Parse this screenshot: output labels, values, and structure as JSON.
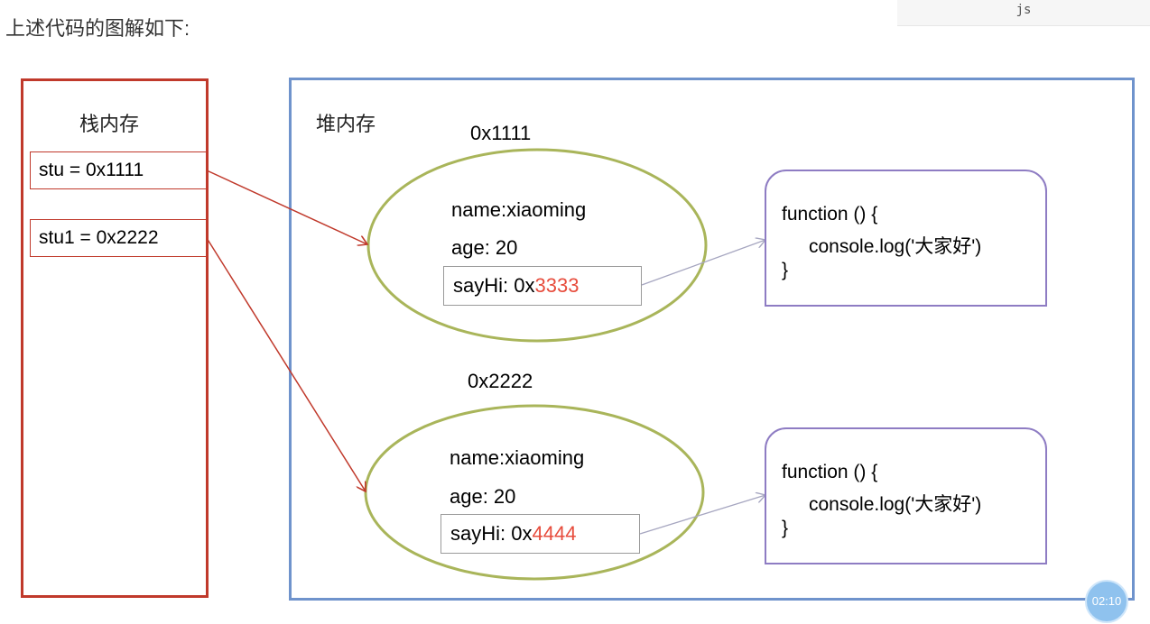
{
  "heading": "上述代码的图解如下:",
  "code_lang": "js",
  "stack": {
    "title": "栈内存",
    "vars": [
      {
        "text": "stu = 0x1111"
      },
      {
        "text": "stu1 = 0x2222"
      }
    ]
  },
  "heap": {
    "title": "堆内存",
    "objects": [
      {
        "address": "0x1111",
        "name_line": "name:xiaoming",
        "age_line": "age: 20",
        "sayhi_prefix": "sayHi: 0x",
        "sayhi_highlight": "3333",
        "fn": {
          "line1": "function () {",
          "line2": "console.log('大家好')",
          "line3": "}"
        }
      },
      {
        "address": "0x2222",
        "name_line": "name:xiaoming",
        "age_line": "age: 20",
        "sayhi_prefix": "sayHi: 0x",
        "sayhi_highlight": "4444",
        "fn": {
          "line1": "function () {",
          "line2": "console.log('大家好')",
          "line3": "}"
        }
      }
    ]
  },
  "timer": "02:10",
  "colors": {
    "stack_border": "#c0392b",
    "heap_border": "#6f93cc",
    "ellipse": "#a9b55a",
    "fn_border": "#8e7cc3",
    "highlight": "#e74c3c"
  }
}
